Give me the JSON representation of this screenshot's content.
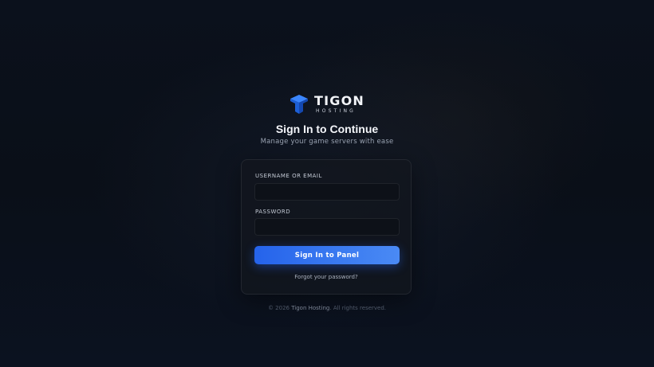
{
  "brand": {
    "name": "TIGON",
    "subtitle": "HOSTING",
    "icon": "cube-icon",
    "accent_color": "#1e6ff0"
  },
  "heading": {
    "title": "Sign In to Continue",
    "subtitle": "Manage your game servers with ease"
  },
  "form": {
    "username_label": "USERNAME OR EMAIL",
    "username_value": "",
    "username_placeholder": "",
    "password_label": "PASSWORD",
    "password_value": "",
    "password_placeholder": "",
    "submit_label": "Sign In to Panel",
    "forgot_label": "Forgot your password?",
    "button_color": "#2563eb"
  },
  "footer": {
    "prefix": "© 2026 ",
    "company": "Tigon Hosting",
    "suffix": ". All rights reserved."
  }
}
